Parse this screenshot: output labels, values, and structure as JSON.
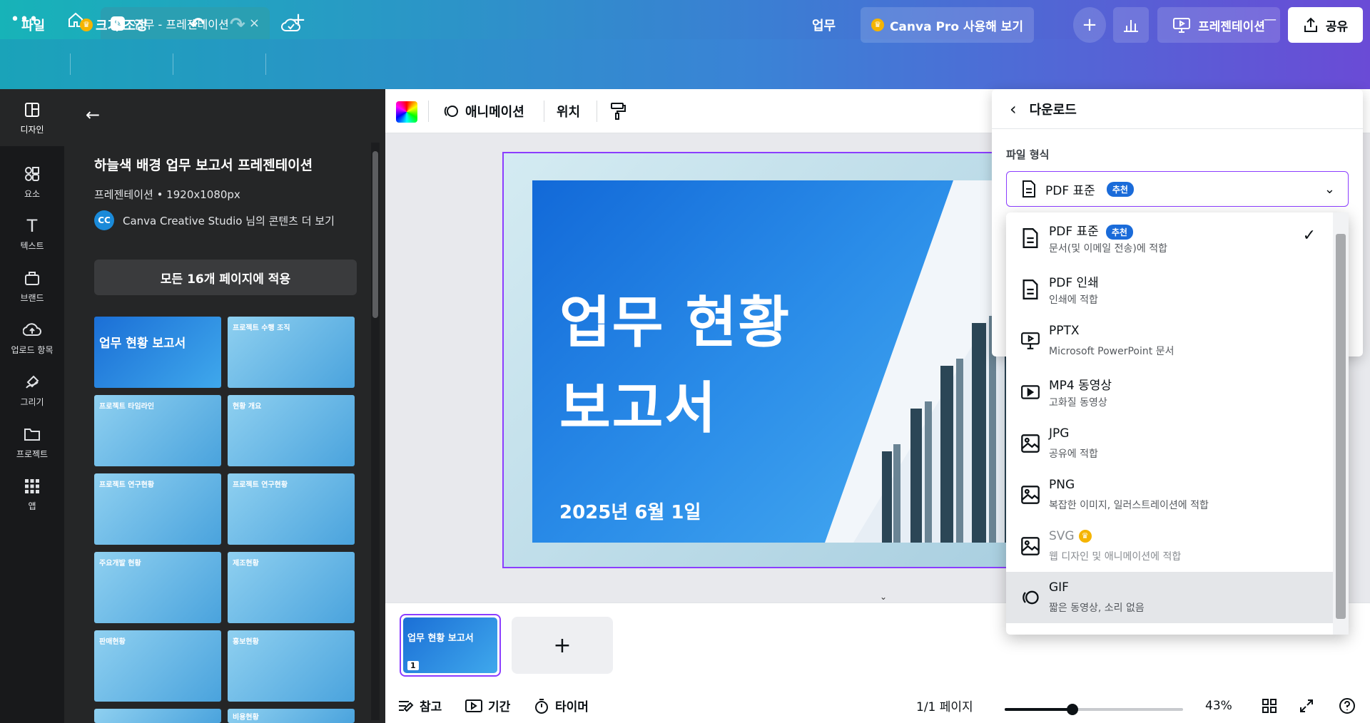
{
  "window": {
    "tab_title": "업무 - 프레젠테이션"
  },
  "toolbar": {
    "file": "파일",
    "resize": "크기 조정",
    "doc_name": "업무",
    "pro_trial": "Canva Pro 사용해 보기",
    "present": "프레젠테이션",
    "share": "공유"
  },
  "rail": {
    "items": [
      {
        "label": "디자인",
        "icon": "design-icon"
      },
      {
        "label": "요소",
        "icon": "elements-icon"
      },
      {
        "label": "텍스트",
        "icon": "text-icon"
      },
      {
        "label": "브랜드",
        "icon": "brand-icon"
      },
      {
        "label": "업로드 항목",
        "icon": "upload-icon"
      },
      {
        "label": "그리기",
        "icon": "draw-icon"
      },
      {
        "label": "프로젝트",
        "icon": "folder-icon"
      },
      {
        "label": "앱",
        "icon": "apps-icon"
      }
    ]
  },
  "panel": {
    "title": "하늘색 배경 업무 보고서 프레젠테이션",
    "meta": "프레젠테이션 • 1920x1080px",
    "author_initials": "CC",
    "author_text": "Canva Creative Studio 님의 콘텐츠 더 보기",
    "apply_all": "모든 16개 페이지에 적용",
    "thumbnails": [
      "업무 현황 보고서",
      "프로젝트 수행 조직",
      "프로젝트 타임라인",
      "현황 개요",
      "프로젝트 연구현황",
      "프로젝트 연구현황",
      "주요개발 현황",
      "제조현황",
      "판매현황",
      "홍보현황",
      "",
      "비용현황"
    ]
  },
  "editor_toolbar": {
    "animation": "애니메이션",
    "position": "위치"
  },
  "slide": {
    "title_line1": "업무 현황",
    "title_line2": "보고서",
    "date": "2025년 6월 1일"
  },
  "page_strip": {
    "thumb_title": "업무 현황 보고서",
    "page_number": "1"
  },
  "footer": {
    "notes": "참고",
    "duration": "기간",
    "timer": "타이머",
    "page_count": "1/1 페이지",
    "zoom": "43%",
    "zoom_fraction": 0.38
  },
  "download": {
    "header": "다운로드",
    "file_type_label": "파일 형식",
    "selected": "PDF 표준",
    "recommended_badge": "추천",
    "options": [
      {
        "title": "PDF 표준",
        "desc": "문서(및 이메일 전송)에 적합",
        "icon": "document-icon"
      },
      {
        "title": "PDF 인쇄",
        "desc": "인쇄에 적합",
        "icon": "document-icon"
      },
      {
        "title": "PPTX",
        "desc": "Microsoft PowerPoint 문서",
        "icon": "presentation-icon"
      },
      {
        "title": "MP4 동영상",
        "desc": "고화질 동영상",
        "icon": "video-icon"
      },
      {
        "title": "JPG",
        "desc": "공유에 적합",
        "icon": "image-icon"
      },
      {
        "title": "PNG",
        "desc": "복잡한 이미지, 일러스트레이션에 적합",
        "icon": "image-icon"
      },
      {
        "title": "SVG",
        "desc": "웹 디자인 및 애니메이션에 적합",
        "icon": "image-icon"
      },
      {
        "title": "GIF",
        "desc": "짧은 동영상, 소리 없음",
        "icon": "gif-icon"
      }
    ]
  },
  "colors": {
    "accent": "#8b3dff",
    "badge": "#1a6bd9",
    "panel_dark": "#252627"
  }
}
